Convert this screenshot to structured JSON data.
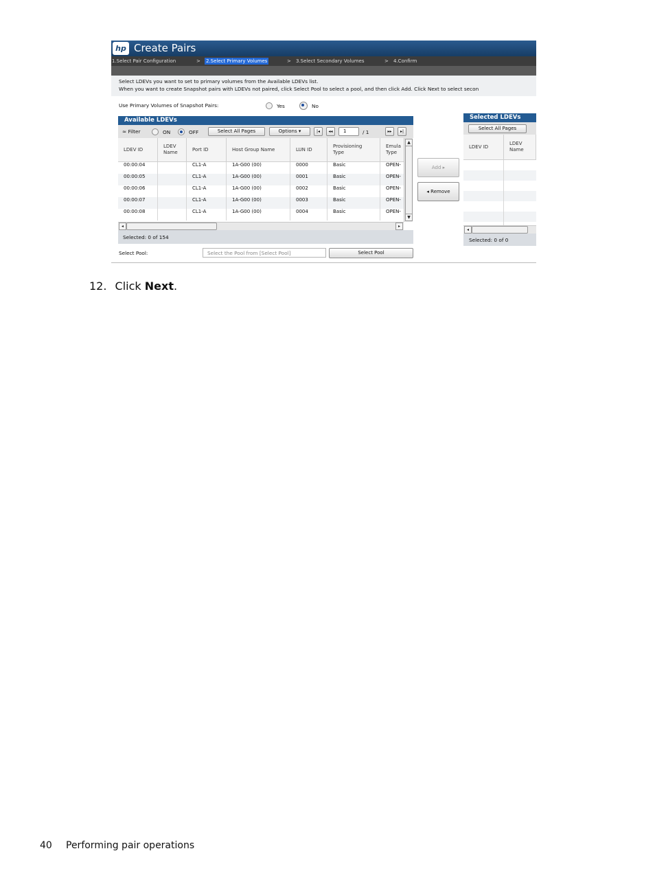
{
  "window": {
    "logo_text": "hp",
    "title": "Create Pairs",
    "steps": [
      "1.Select Pair Configuration",
      ">",
      "2.Select Primary Volumes",
      ">",
      "3.Select Secondary Volumes",
      ">",
      "4.Confirm"
    ]
  },
  "instructions": {
    "line1": "Select LDEVs you want to set to primary volumes from the Available LDEVs list.",
    "line2": "When you want to create Snapshot pairs with LDEVs not paired, click Select Pool to select a pool, and then click Add. Click Next to select secon"
  },
  "snapshot_option": {
    "label": "Use Primary Volumes of Snapshot Pairs:",
    "yes_label": "Yes",
    "no_label": "No",
    "selected": "No"
  },
  "available": {
    "title": "Available LDEVs",
    "filter_label": "Filter",
    "on_label": "ON",
    "off_label": "OFF",
    "select_all_label": "Select All Pages",
    "options_label": "Options",
    "page_value": "1",
    "page_total": "/ 1",
    "columns": [
      [
        "LDEV ID",
        ""
      ],
      [
        "LDEV",
        "Name"
      ],
      [
        "Port ID",
        ""
      ],
      [
        "Host Group Name",
        ""
      ],
      [
        "LUN ID",
        ""
      ],
      [
        "Provisioning",
        "Type"
      ],
      [
        "Emula",
        "Type"
      ]
    ],
    "rows": [
      [
        "00:00:04",
        "",
        "CL1-A",
        "1A-G00 (00)",
        "0000",
        "Basic",
        "OPEN-"
      ],
      [
        "00:00:05",
        "",
        "CL1-A",
        "1A-G00 (00)",
        "0001",
        "Basic",
        "OPEN-"
      ],
      [
        "00:00:06",
        "",
        "CL1-A",
        "1A-G00 (00)",
        "0002",
        "Basic",
        "OPEN-"
      ],
      [
        "00:00:07",
        "",
        "CL1-A",
        "1A-G00 (00)",
        "0003",
        "Basic",
        "OPEN-"
      ],
      [
        "00:00:08",
        "",
        "CL1-A",
        "1A-G00 (00)",
        "0004",
        "Basic",
        "OPEN-"
      ]
    ],
    "selected_text": "Selected:  0    of  154"
  },
  "actions": {
    "add_label": "Add",
    "remove_label": "Remove"
  },
  "selected_panel": {
    "title": "Selected LDEVs",
    "select_all_label": "Select All Pages",
    "columns": [
      [
        "LDEV ID",
        ""
      ],
      [
        "LDEV",
        "Name"
      ]
    ],
    "selected_text": "Selected:  0    of  0"
  },
  "pool": {
    "label": "Select Pool:",
    "placeholder": "Select the Pool from [Select Pool]",
    "button_label": "Select Pool"
  },
  "document": {
    "step_number": "12.",
    "step_prefix": "Click ",
    "step_bold": "Next",
    "step_suffix": ".",
    "page_number": "40",
    "footer_title": "Performing pair operations"
  },
  "colors": {
    "title_bar": "#1d4a78",
    "panel_header": "#235b93",
    "active_step": "#2469d6"
  }
}
